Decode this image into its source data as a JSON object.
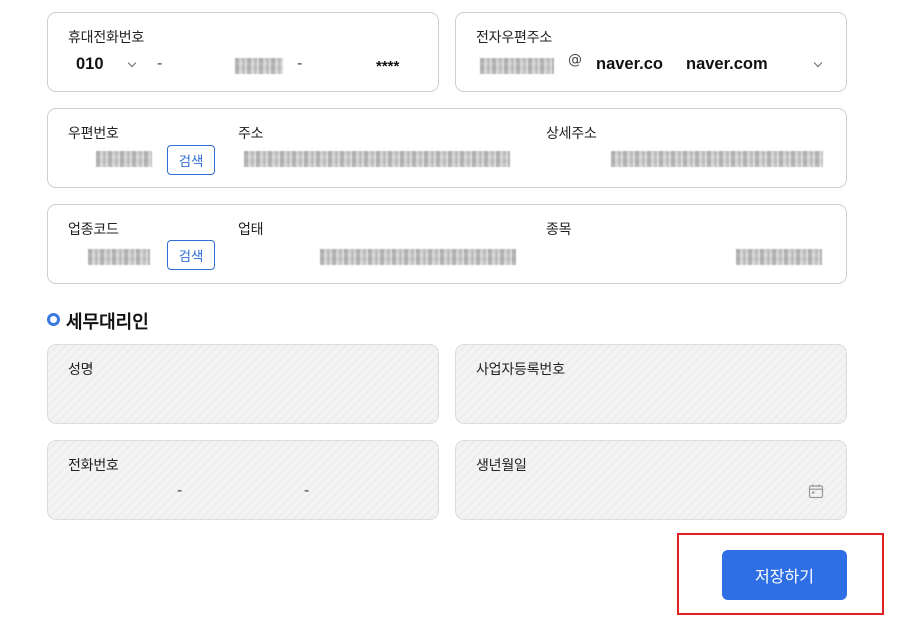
{
  "mobile": {
    "label": "휴대전화번호",
    "prefix": "010",
    "sep1": "-",
    "sep2": "-",
    "last": "****"
  },
  "email": {
    "label": "전자우편주소",
    "at": "@",
    "domain_input": "naver.co",
    "domain_select": "naver.com"
  },
  "address": {
    "zip_label": "우편번호",
    "addr_label": "주소",
    "detail_label": "상세주소",
    "search_label": "검색"
  },
  "business": {
    "code_label": "업종코드",
    "type_label": "업태",
    "item_label": "종목",
    "search_label": "검색"
  },
  "agent": {
    "section_title": "세무대리인",
    "name_label": "성명",
    "bizno_label": "사업자등록번호",
    "phone_label": "전화번호",
    "phone_sep1": "-",
    "phone_sep2": "-",
    "birth_label": "생년월일"
  },
  "actions": {
    "save_label": "저장하기"
  },
  "colors": {
    "accent": "#2e6fe6",
    "highlight": "#e01f1f"
  }
}
